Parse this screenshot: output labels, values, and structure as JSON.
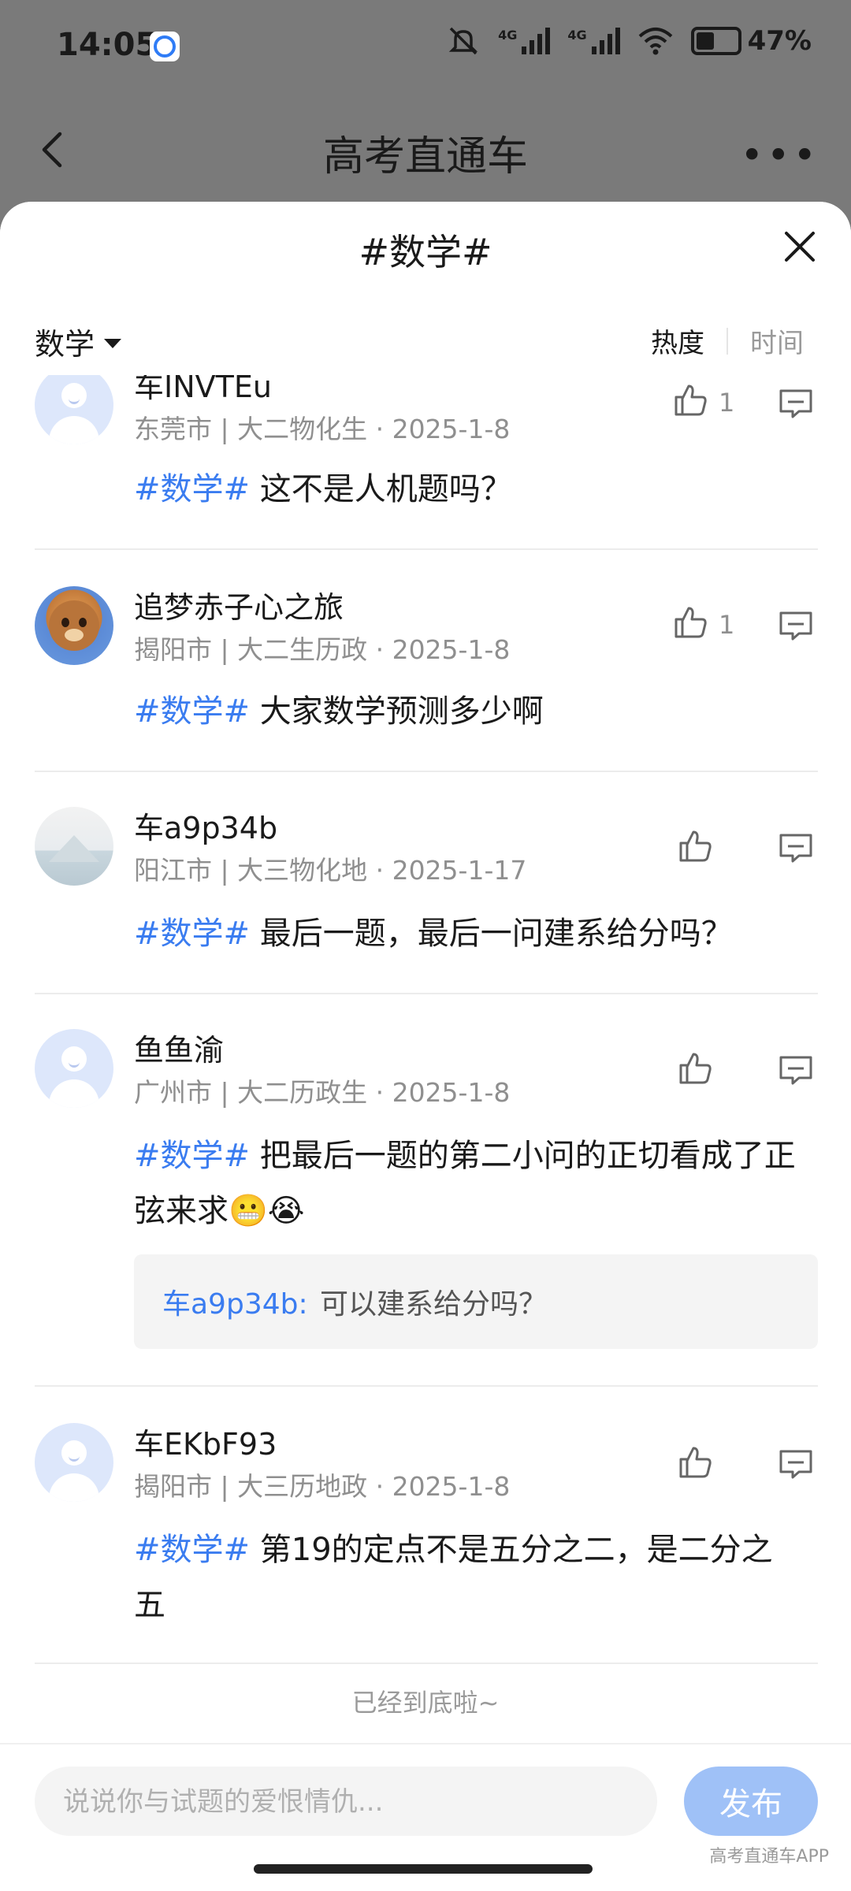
{
  "status": {
    "time": "14:05",
    "net1": "4G",
    "net2": "4G",
    "battery": "47%"
  },
  "header": {
    "title": "高考直通车"
  },
  "sheet": {
    "title": "#数学#",
    "subject": "数学",
    "sort_hot": "热度",
    "sort_time": "时间"
  },
  "posts": [
    {
      "name": "车INVTEu",
      "meta": "东莞市 | 大二物化生 · 2025-1-8",
      "likes": "1",
      "tag": "#数学#",
      "text": " 这不是人机题吗？"
    },
    {
      "name": "追梦赤子心之旅",
      "meta": "揭阳市 | 大二生历政 · 2025-1-8",
      "likes": "1",
      "tag": "#数学#",
      "text": " 大家数学预测多少啊"
    },
    {
      "name": "车a9p34b",
      "meta": "阳江市 | 大三物化地 · 2025-1-17",
      "likes": "",
      "tag": "#数学#",
      "text": " 最后一题，最后一问建系给分吗？"
    },
    {
      "name": "鱼鱼渝",
      "meta": "广州市 | 大二历政生 · 2025-1-8",
      "likes": "",
      "tag": "#数学#",
      "text": " 把最后一题的第二小问的正切看成了正弦来求😬😭",
      "reply": {
        "user": "车a9p34b:",
        "text": "可以建系给分吗？"
      }
    },
    {
      "name": "车EKbF93",
      "meta": "揭阳市 | 大三历地政 · 2025-1-8",
      "likes": "",
      "tag": "#数学#",
      "text": " 第19的定点不是五分之二，是二分之五"
    }
  ],
  "footer": {
    "end_text": "已经到底啦~",
    "input_placeholder": "说说你与试题的爱恨情仇...",
    "publish": "发布",
    "watermark": "高考直通车APP"
  },
  "colors": {
    "accent": "#3a7cf0",
    "publish_bg": "#9fc1f7"
  },
  "icons": [
    "back-arrow-icon",
    "more-icon",
    "close-icon",
    "caret-down-icon",
    "thumb-up-icon",
    "comment-icon"
  ]
}
